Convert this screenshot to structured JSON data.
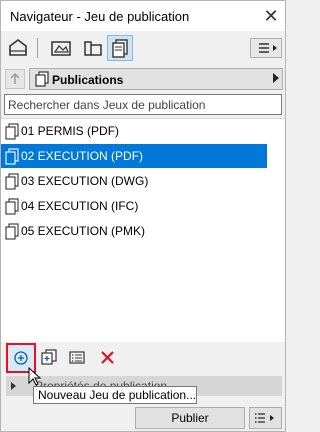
{
  "window": {
    "title": "Navigateur - Jeu de publication",
    "close_glyph": "✕"
  },
  "mode_toolbar": {
    "modes": [
      {
        "name": "project-map-icon",
        "active": false
      },
      {
        "name": "view-map-icon",
        "active": false
      },
      {
        "name": "layout-book-icon",
        "active": false
      },
      {
        "name": "publisher-sets-icon",
        "active": true
      }
    ],
    "menu_icon": "hamburger-icon"
  },
  "selector": {
    "label": "Publications",
    "up_icon": "arrow-up-icon"
  },
  "search": {
    "placeholder": "Rechercher dans Jeux de publication",
    "value": ""
  },
  "list": {
    "items": [
      {
        "label": "01 PERMIS (PDF)",
        "selected": false
      },
      {
        "label": "02 EXECUTION (PDF)",
        "selected": true
      },
      {
        "label": "03 EXECUTION (DWG)",
        "selected": false
      },
      {
        "label": "04 EXECUTION (IFC)",
        "selected": false
      },
      {
        "label": "05 EXECUTION (PMK)",
        "selected": false
      }
    ]
  },
  "bottom_toolbar": {
    "buttons": [
      "new-publisher-set-icon",
      "new-subset-icon",
      "settings-icon",
      "delete-icon"
    ],
    "delete_color": "#e81123"
  },
  "properties": {
    "label": "Propriétés de publication"
  },
  "tooltip": {
    "text": "Nouveau Jeu de publication..."
  },
  "publish": {
    "label": "Publier"
  },
  "colors": {
    "selection": "#0078d7",
    "highlight": "#e81123"
  }
}
